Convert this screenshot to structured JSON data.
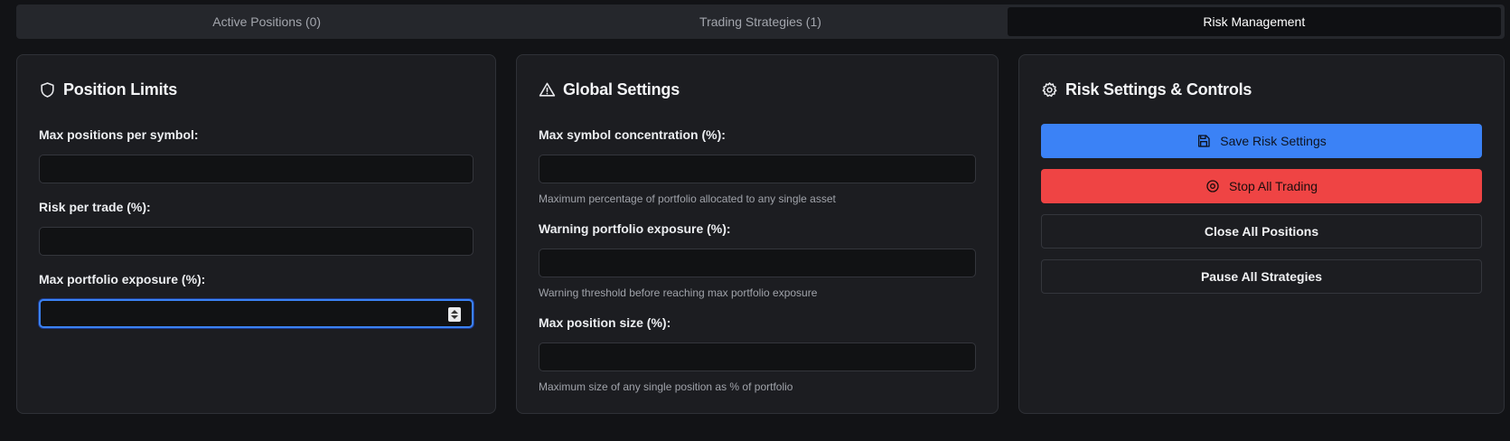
{
  "tabs": [
    {
      "label": "Active Positions (0)"
    },
    {
      "label": "Trading Strategies (1)"
    },
    {
      "label": "Risk Management"
    }
  ],
  "position_limits": {
    "title": "Position Limits",
    "icon": "shield-icon",
    "fields": [
      {
        "label": "Max positions per symbol:",
        "value": ""
      },
      {
        "label": "Risk per trade (%):",
        "value": ""
      },
      {
        "label": "Max portfolio exposure (%):",
        "value": ""
      }
    ]
  },
  "global_settings": {
    "title": "Global Settings",
    "icon": "warning-triangle-icon",
    "fields": [
      {
        "label": "Max symbol concentration (%):",
        "value": "",
        "hint": "Maximum percentage of portfolio allocated to any single asset"
      },
      {
        "label": "Warning portfolio exposure (%):",
        "value": "",
        "hint": "Warning threshold before reaching max portfolio exposure"
      },
      {
        "label": "Max position size (%):",
        "value": "",
        "hint": "Maximum size of any single position as % of portfolio"
      }
    ]
  },
  "risk_controls": {
    "title": "Risk Settings & Controls",
    "icon": "gear-icon",
    "buttons": [
      {
        "label": "Save Risk Settings",
        "icon": "save-icon"
      },
      {
        "label": "Stop All Trading",
        "icon": "stop-circle-icon"
      },
      {
        "label": "Close All Positions"
      },
      {
        "label": "Pause All Strategies"
      }
    ]
  },
  "colors": {
    "accent": "#3b82f6",
    "danger": "#ef4444",
    "background": "#121316",
    "card": "#1c1d21"
  }
}
